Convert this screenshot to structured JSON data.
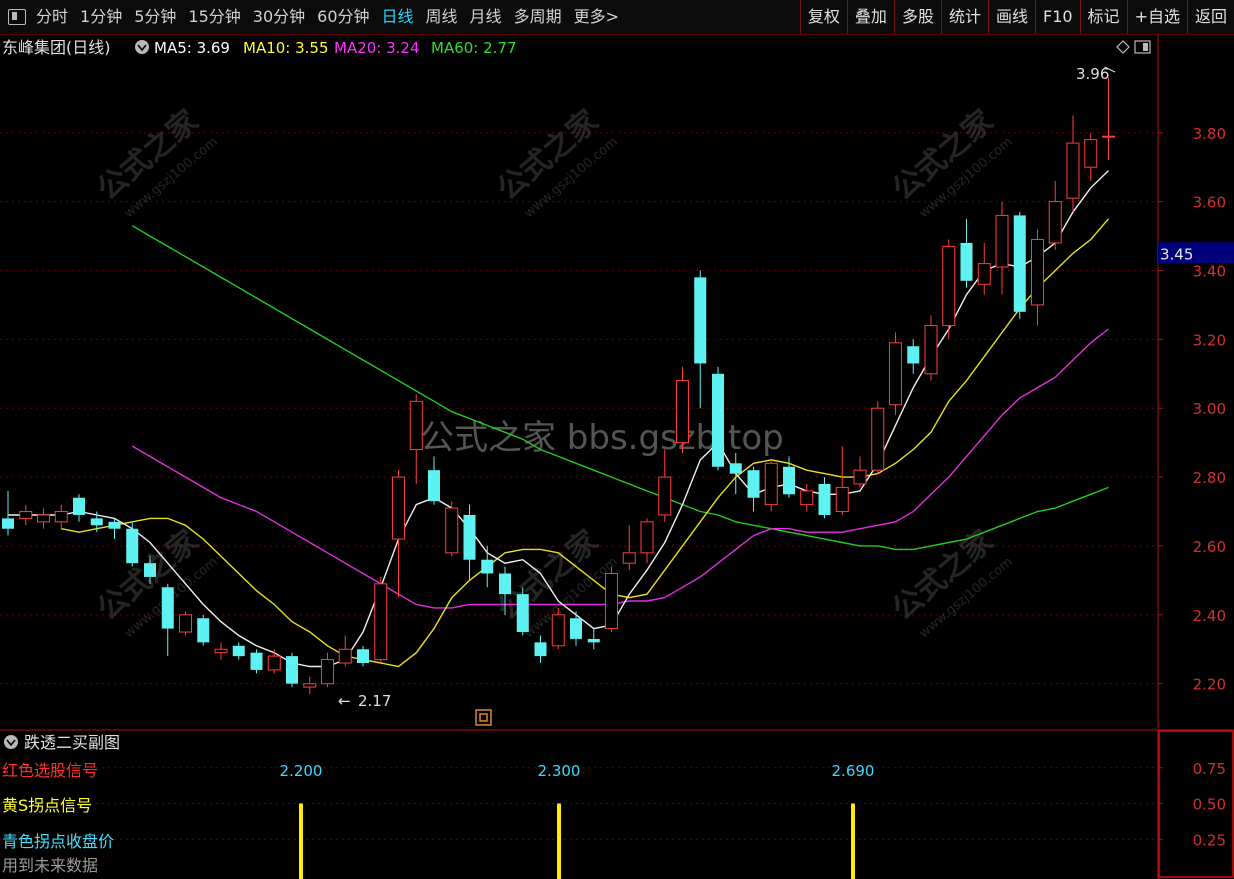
{
  "toolbar": {
    "periods": [
      "分时",
      "1分钟",
      "5分钟",
      "15分钟",
      "30分钟",
      "60分钟",
      "日线",
      "周线",
      "月线",
      "多周期",
      "更多>"
    ],
    "active_period": "日线",
    "buttons": [
      "复权",
      "叠加",
      "多股",
      "统计",
      "画线",
      "F10",
      "标记",
      "+自选",
      "返回"
    ]
  },
  "main": {
    "stock_title": "东峰集团(日线)",
    "ma_labels": [
      {
        "name": "MA5: 3.69",
        "color": "#ffffff"
      },
      {
        "name": "MA10: 3.55",
        "color": "#ffff33"
      },
      {
        "name": "MA20: 3.24",
        "color": "#ff33ff"
      },
      {
        "name": "MA60: 2.77",
        "color": "#33dd33"
      }
    ],
    "high_marker": "3.96",
    "low_marker": "2.17",
    "current_price": "3.45",
    "watermark_center": "公式之家 bbs.gszb.top",
    "watermark_tile_title": "公式之家",
    "watermark_tile_url": "www.gszj100.com"
  },
  "sub": {
    "title": "跌透二买副图",
    "lines": [
      {
        "text": "红色选股信号",
        "color": "#ff3030"
      },
      {
        "text": "黄S拐点信号",
        "color": "#ffff33"
      },
      {
        "text": "青色拐点收盘价",
        "color": "#40e0ff"
      },
      {
        "text": "用到未来数据",
        "color": "#9a9a9a"
      }
    ],
    "signal_values": [
      "2.200",
      "2.300",
      "2.690"
    ],
    "y_ticks": [
      "0.75",
      "0.50",
      "0.25"
    ]
  },
  "chart_data": {
    "type": "candlestick",
    "y_ticks": [
      "2.20",
      "2.40",
      "2.60",
      "2.80",
      "3.00",
      "3.20",
      "3.40",
      "3.60",
      "3.80"
    ],
    "ylim": [
      2.08,
      4.02
    ],
    "candles": [
      {
        "o": 2.68,
        "c": 2.65,
        "h": 2.76,
        "l": 2.63
      },
      {
        "o": 2.68,
        "c": 2.7,
        "h": 2.72,
        "l": 2.66
      },
      {
        "o": 2.67,
        "c": 2.69,
        "h": 2.71,
        "l": 2.65
      },
      {
        "o": 2.67,
        "c": 2.7,
        "h": 2.72,
        "l": 2.65
      },
      {
        "o": 2.74,
        "c": 2.69,
        "h": 2.75,
        "l": 2.67
      },
      {
        "o": 2.68,
        "c": 2.66,
        "h": 2.7,
        "l": 2.64
      },
      {
        "o": 2.67,
        "c": 2.65,
        "h": 2.68,
        "l": 2.62
      },
      {
        "o": 2.65,
        "c": 2.55,
        "h": 2.67,
        "l": 2.54
      },
      {
        "o": 2.55,
        "c": 2.51,
        "h": 2.57,
        "l": 2.49
      },
      {
        "o": 2.48,
        "c": 2.36,
        "h": 2.49,
        "l": 2.28
      },
      {
        "o": 2.35,
        "c": 2.4,
        "h": 2.41,
        "l": 2.34
      },
      {
        "o": 2.39,
        "c": 2.32,
        "h": 2.4,
        "l": 2.31
      },
      {
        "o": 2.29,
        "c": 2.3,
        "h": 2.32,
        "l": 2.27
      },
      {
        "o": 2.31,
        "c": 2.28,
        "h": 2.32,
        "l": 2.27
      },
      {
        "o": 2.29,
        "c": 2.24,
        "h": 2.3,
        "l": 2.23
      },
      {
        "o": 2.24,
        "c": 2.28,
        "h": 2.3,
        "l": 2.23
      },
      {
        "o": 2.28,
        "c": 2.2,
        "h": 2.29,
        "l": 2.19
      },
      {
        "o": 2.19,
        "c": 2.2,
        "h": 2.22,
        "l": 2.17
      },
      {
        "o": 2.2,
        "c": 2.27,
        "h": 2.29,
        "l": 2.19
      },
      {
        "o": 2.26,
        "c": 2.3,
        "h": 2.34,
        "l": 2.25
      },
      {
        "o": 2.3,
        "c": 2.26,
        "h": 2.31,
        "l": 2.25
      },
      {
        "o": 2.27,
        "c": 2.49,
        "h": 2.51,
        "l": 2.26
      },
      {
        "o": 2.62,
        "c": 2.8,
        "h": 2.82,
        "l": 2.45
      },
      {
        "o": 2.88,
        "c": 3.02,
        "h": 3.04,
        "l": 2.78
      },
      {
        "o": 2.82,
        "c": 2.73,
        "h": 2.86,
        "l": 2.72
      },
      {
        "o": 2.58,
        "c": 2.71,
        "h": 2.73,
        "l": 2.57
      },
      {
        "o": 2.69,
        "c": 2.56,
        "h": 2.72,
        "l": 2.5
      },
      {
        "o": 2.56,
        "c": 2.52,
        "h": 2.6,
        "l": 2.48
      },
      {
        "o": 2.52,
        "c": 2.46,
        "h": 2.54,
        "l": 2.4
      },
      {
        "o": 2.46,
        "c": 2.35,
        "h": 2.48,
        "l": 2.34
      },
      {
        "o": 2.32,
        "c": 2.28,
        "h": 2.34,
        "l": 2.26
      },
      {
        "o": 2.31,
        "c": 2.4,
        "h": 2.42,
        "l": 2.3
      },
      {
        "o": 2.39,
        "c": 2.33,
        "h": 2.41,
        "l": 2.31
      },
      {
        "o": 2.33,
        "c": 2.32,
        "h": 2.36,
        "l": 2.3
      },
      {
        "o": 2.36,
        "c": 2.52,
        "h": 2.54,
        "l": 2.35
      },
      {
        "o": 2.55,
        "c": 2.58,
        "h": 2.66,
        "l": 2.53
      },
      {
        "o": 2.58,
        "c": 2.67,
        "h": 2.68,
        "l": 2.55
      },
      {
        "o": 2.69,
        "c": 2.8,
        "h": 2.88,
        "l": 2.67
      },
      {
        "o": 2.9,
        "c": 3.08,
        "h": 3.12,
        "l": 2.87
      },
      {
        "o": 3.38,
        "c": 3.13,
        "h": 3.4,
        "l": 3.0
      },
      {
        "o": 3.1,
        "c": 2.83,
        "h": 3.12,
        "l": 2.82
      },
      {
        "o": 2.84,
        "c": 2.81,
        "h": 2.87,
        "l": 2.75
      },
      {
        "o": 2.82,
        "c": 2.74,
        "h": 2.83,
        "l": 2.7
      },
      {
        "o": 2.72,
        "c": 2.84,
        "h": 2.85,
        "l": 2.7
      },
      {
        "o": 2.83,
        "c": 2.75,
        "h": 2.86,
        "l": 2.74
      },
      {
        "o": 2.72,
        "c": 2.76,
        "h": 2.78,
        "l": 2.7
      },
      {
        "o": 2.78,
        "c": 2.69,
        "h": 2.8,
        "l": 2.68
      },
      {
        "o": 2.7,
        "c": 2.77,
        "h": 2.89,
        "l": 2.69
      },
      {
        "o": 2.78,
        "c": 2.82,
        "h": 2.86,
        "l": 2.77
      },
      {
        "o": 2.82,
        "c": 3.0,
        "h": 3.02,
        "l": 2.81
      },
      {
        "o": 3.01,
        "c": 3.19,
        "h": 3.22,
        "l": 2.98
      },
      {
        "o": 3.18,
        "c": 3.13,
        "h": 3.2,
        "l": 3.1
      },
      {
        "o": 3.1,
        "c": 3.24,
        "h": 3.27,
        "l": 3.08
      },
      {
        "o": 3.24,
        "c": 3.47,
        "h": 3.49,
        "l": 3.2
      },
      {
        "o": 3.48,
        "c": 3.37,
        "h": 3.55,
        "l": 3.35
      },
      {
        "o": 3.36,
        "c": 3.42,
        "h": 3.48,
        "l": 3.33
      },
      {
        "o": 3.41,
        "c": 3.56,
        "h": 3.6,
        "l": 3.33
      },
      {
        "o": 3.56,
        "c": 3.28,
        "h": 3.57,
        "l": 3.26
      },
      {
        "o": 3.3,
        "c": 3.49,
        "h": 3.52,
        "l": 3.24
      },
      {
        "o": 3.48,
        "c": 3.6,
        "h": 3.66,
        "l": 3.46
      },
      {
        "o": 3.61,
        "c": 3.77,
        "h": 3.85,
        "l": 3.57
      },
      {
        "o": 3.7,
        "c": 3.78,
        "h": 3.8,
        "l": 3.66
      },
      {
        "o": 3.79,
        "c": 3.79,
        "h": 3.96,
        "l": 3.72
      }
    ],
    "ma5": [
      2.69,
      2.69,
      2.69,
      2.69,
      2.7,
      2.69,
      2.68,
      2.65,
      2.61,
      2.55,
      2.49,
      2.43,
      2.38,
      2.34,
      2.31,
      2.29,
      2.26,
      2.25,
      2.25,
      2.27,
      2.35,
      2.48,
      2.62,
      2.72,
      2.74,
      2.71,
      2.65,
      2.58,
      2.55,
      2.56,
      2.52,
      2.44,
      2.4,
      2.36,
      2.37,
      2.46,
      2.53,
      2.61,
      2.72,
      2.85,
      2.9,
      2.81,
      2.75,
      2.77,
      2.78,
      2.76,
      2.75,
      2.75,
      2.76,
      2.84,
      2.95,
      3.06,
      3.15,
      3.23,
      3.33,
      3.4,
      3.42,
      3.41,
      3.44,
      3.48,
      3.57,
      3.64,
      3.69
    ],
    "ma10": [
      2.65,
      2.64,
      2.65,
      2.66,
      2.67,
      2.68,
      2.68,
      2.66,
      2.62,
      2.57,
      2.52,
      2.47,
      2.43,
      2.38,
      2.35,
      2.31,
      2.28,
      2.27,
      2.26,
      2.25,
      2.29,
      2.36,
      2.45,
      2.5,
      2.54,
      2.58,
      2.59,
      2.59,
      2.58,
      2.54,
      2.5,
      2.46,
      2.45,
      2.46,
      2.53,
      2.6,
      2.67,
      2.74,
      2.8,
      2.84,
      2.85,
      2.84,
      2.82,
      2.81,
      2.8,
      2.8,
      2.81,
      2.84,
      2.88,
      2.93,
      3.02,
      3.08,
      3.15,
      3.22,
      3.29,
      3.35,
      3.4,
      3.45,
      3.49,
      3.55
    ],
    "ma20": [
      2.89,
      2.86,
      2.83,
      2.8,
      2.77,
      2.74,
      2.72,
      2.7,
      2.67,
      2.64,
      2.61,
      2.58,
      2.55,
      2.52,
      2.49,
      2.46,
      2.43,
      2.42,
      2.42,
      2.43,
      2.43,
      2.43,
      2.43,
      2.43,
      2.43,
      2.43,
      2.43,
      2.43,
      2.44,
      2.44,
      2.45,
      2.48,
      2.51,
      2.55,
      2.59,
      2.63,
      2.65,
      2.65,
      2.64,
      2.64,
      2.64,
      2.65,
      2.66,
      2.67,
      2.7,
      2.75,
      2.8,
      2.86,
      2.92,
      2.98,
      3.03,
      3.06,
      3.09,
      3.14,
      3.19,
      3.23
    ],
    "ma60": [
      3.53,
      3.5,
      3.47,
      3.44,
      3.41,
      3.38,
      3.35,
      3.32,
      3.29,
      3.26,
      3.23,
      3.2,
      3.17,
      3.14,
      3.11,
      3.08,
      3.05,
      3.02,
      2.99,
      2.97,
      2.95,
      2.93,
      2.91,
      2.88,
      2.86,
      2.84,
      2.82,
      2.8,
      2.78,
      2.76,
      2.74,
      2.72,
      2.7,
      2.69,
      2.67,
      2.66,
      2.65,
      2.64,
      2.63,
      2.62,
      2.61,
      2.6,
      2.6,
      2.59,
      2.59,
      2.6,
      2.61,
      2.62,
      2.64,
      2.66,
      2.68,
      2.7,
      2.71,
      2.73,
      2.75,
      2.77
    ],
    "sub_signal_indices": [
      17,
      33,
      48
    ]
  }
}
